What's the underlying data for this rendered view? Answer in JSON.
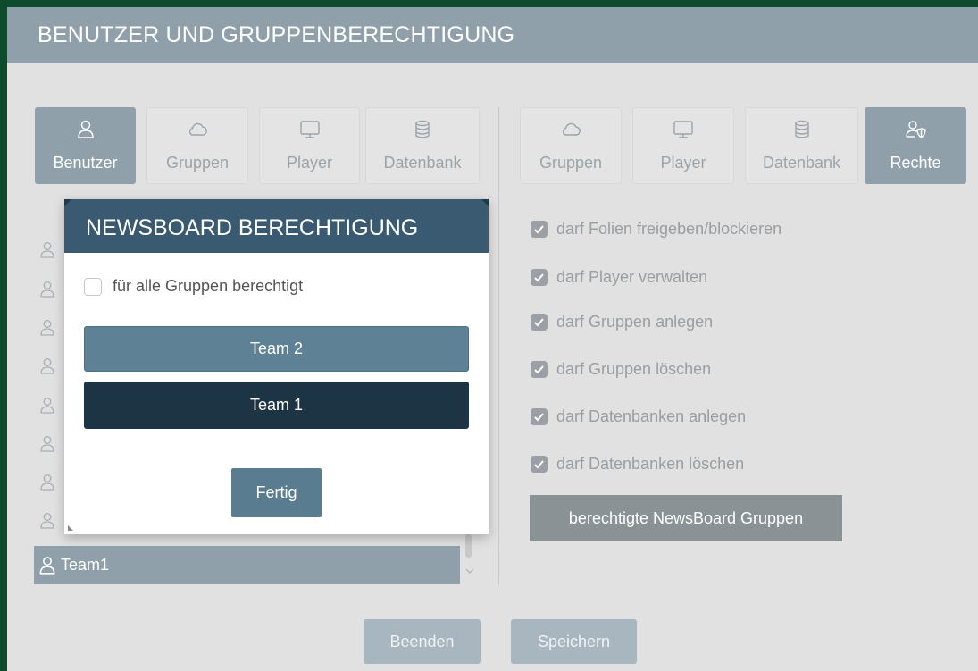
{
  "header": {
    "title": "BENUTZER UND GRUPPENBERECHTIGUNG"
  },
  "left_tabs": [
    {
      "label": "Benutzer",
      "icon": "user-icon",
      "active": true
    },
    {
      "label": "Gruppen",
      "icon": "cloud-icon",
      "active": false
    },
    {
      "label": "Player",
      "icon": "monitor-icon",
      "active": false
    },
    {
      "label": "Datenbank",
      "icon": "database-icon",
      "active": false
    }
  ],
  "right_tabs": [
    {
      "label": "Gruppen",
      "icon": "cloud-icon",
      "active": false
    },
    {
      "label": "Player",
      "icon": "monitor-icon",
      "active": false
    },
    {
      "label": "Datenbank",
      "icon": "database-icon",
      "active": false
    },
    {
      "label": "Rechte",
      "icon": "user-shield-icon",
      "active": true
    }
  ],
  "user_list": {
    "selected": "Team1"
  },
  "permissions": [
    {
      "label": "darf Folien freigeben/blockieren",
      "checked": true
    },
    {
      "label": "darf Player verwalten",
      "checked": true
    },
    {
      "label": "darf Gruppen anlegen",
      "checked": true
    },
    {
      "label": "darf Gruppen löschen",
      "checked": true
    },
    {
      "label": "darf Datenbanken anlegen",
      "checked": true
    },
    {
      "label": "darf Datenbanken löschen",
      "checked": true
    }
  ],
  "newsboard_button": "berechtigte NewsBoard Gruppen",
  "footer": {
    "close": "Beenden",
    "save": "Speichern"
  },
  "modal": {
    "title": "NEWSBOARD BERECHTIGUNG",
    "all_groups_label": "für alle Gruppen berechtigt",
    "all_groups_checked": false,
    "teams": [
      "Team 2",
      "Team 1"
    ],
    "done": "Fertig"
  },
  "colors": {
    "frame_border": "#0e4a2c",
    "header": "#8fa0aa",
    "modal_header": "#3a5a72",
    "team2": "#5f8195",
    "team1": "#1d3444"
  }
}
